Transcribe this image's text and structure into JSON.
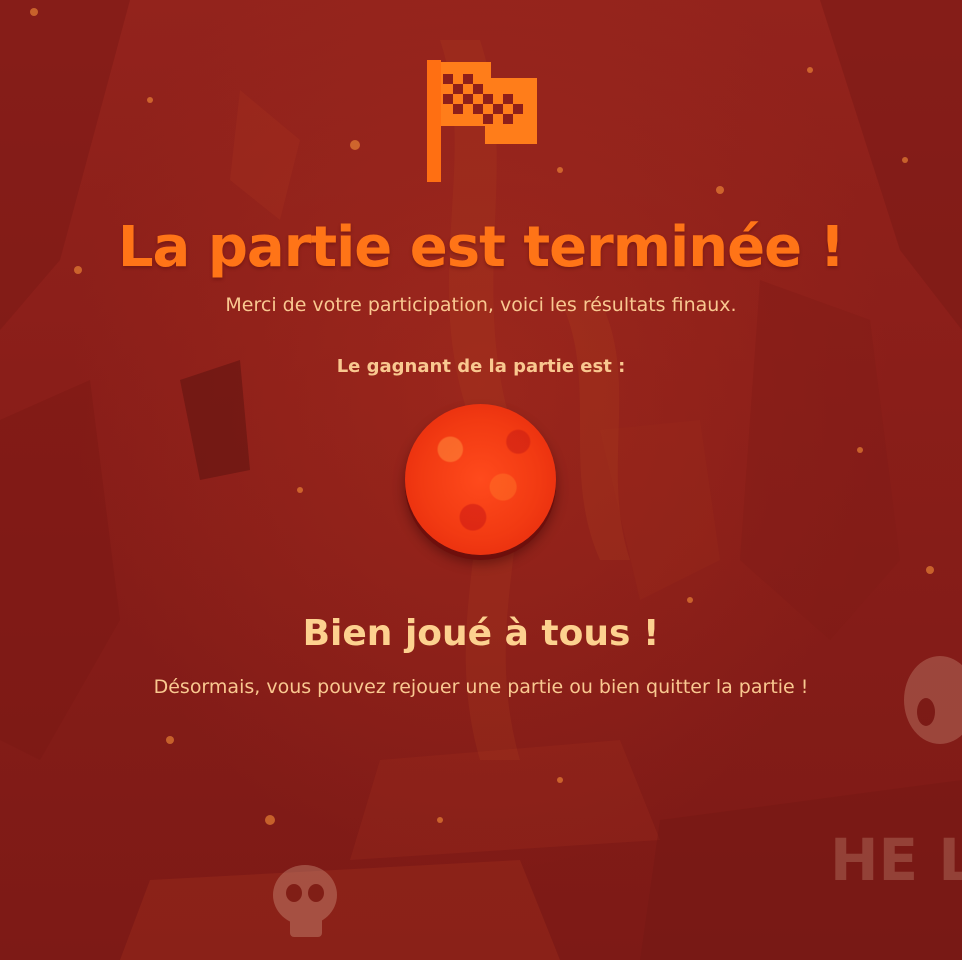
{
  "end_screen": {
    "title": "La partie est terminée !",
    "subtitle": "Merci de votre participation, voici les résultats finaux.",
    "winner_label": "Le gagnant de la partie est :",
    "congrats": "Bien joué à tous !",
    "next_steps": "Désormais, vous pouvez rejouer une partie ou bien quitter la partie !"
  },
  "icons": {
    "flag": "checkered-flag-icon",
    "winner": "winner-avatar"
  },
  "background": {
    "sign_text": "HE L"
  },
  "colors": {
    "accent": "#ff7417",
    "text": "#f9c890",
    "heading": "#fdd18f",
    "background": "#8e1f1a",
    "winner": "#f23a12"
  }
}
